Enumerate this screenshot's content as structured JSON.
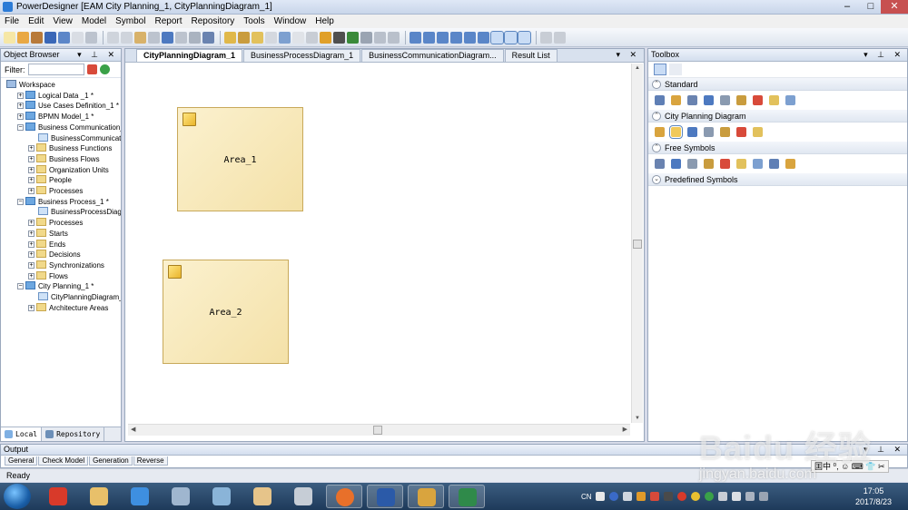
{
  "window": {
    "title": "PowerDesigner [EAM City Planning_1, CityPlanningDiagram_1]",
    "controls": {
      "minimize": "–",
      "maximize": "□",
      "close": "✕"
    }
  },
  "menu": [
    "File",
    "Edit",
    "View",
    "Model",
    "Symbol",
    "Report",
    "Repository",
    "Tools",
    "Window",
    "Help"
  ],
  "object_browser": {
    "title": "Object Browser",
    "controls": "▾ ⊥ ✕",
    "filter_label": "Filter:",
    "filter_value": "",
    "tree": [
      {
        "label": "Workspace",
        "icon": "ws",
        "exp": "",
        "level": 0
      },
      {
        "label": "Logical Data _1 *",
        "icon": "model",
        "exp": "+",
        "level": 1
      },
      {
        "label": "Use Cases Definition_1 *",
        "icon": "model",
        "exp": "+",
        "level": 1
      },
      {
        "label": "BPMN Model_1 *",
        "icon": "model",
        "exp": "+",
        "level": 1
      },
      {
        "label": "Business Communication_",
        "icon": "model",
        "exp": "−",
        "level": 1
      },
      {
        "label": "BusinessCommunicati",
        "icon": "diag",
        "exp": "",
        "level": 2
      },
      {
        "label": "Business Functions",
        "icon": "folder",
        "exp": "+",
        "level": 2
      },
      {
        "label": "Business Flows",
        "icon": "folder",
        "exp": "+",
        "level": 2
      },
      {
        "label": "Organization Units",
        "icon": "folder",
        "exp": "+",
        "level": 2
      },
      {
        "label": "People",
        "icon": "folder",
        "exp": "+",
        "level": 2
      },
      {
        "label": "Processes",
        "icon": "folder",
        "exp": "+",
        "level": 2
      },
      {
        "label": "Business Process_1 *",
        "icon": "model",
        "exp": "−",
        "level": 1
      },
      {
        "label": "BusinessProcessDiagr",
        "icon": "diag",
        "exp": "",
        "level": 2
      },
      {
        "label": "Processes",
        "icon": "folder",
        "exp": "+",
        "level": 2
      },
      {
        "label": "Starts",
        "icon": "folder",
        "exp": "+",
        "level": 2
      },
      {
        "label": "Ends",
        "icon": "folder",
        "exp": "+",
        "level": 2
      },
      {
        "label": "Decisions",
        "icon": "folder",
        "exp": "+",
        "level": 2
      },
      {
        "label": "Synchronizations",
        "icon": "folder",
        "exp": "+",
        "level": 2
      },
      {
        "label": "Flows",
        "icon": "folder",
        "exp": "+",
        "level": 2
      },
      {
        "label": "City Planning_1 *",
        "icon": "model",
        "exp": "−",
        "level": 1
      },
      {
        "label": "CityPlanningDiagram_1",
        "icon": "diag",
        "exp": "",
        "level": 2
      },
      {
        "label": "Architecture Areas",
        "icon": "folder",
        "exp": "+",
        "level": 2
      }
    ],
    "bottom_tabs": [
      {
        "label": "Local",
        "active": true
      },
      {
        "label": "Repository",
        "active": false
      }
    ]
  },
  "document": {
    "tabs": [
      {
        "label": "CityPlanningDiagram_1",
        "active": true
      },
      {
        "label": "BusinessProcessDiagram_1",
        "active": false
      },
      {
        "label": "BusinessCommunicationDiagram...",
        "active": false
      },
      {
        "label": "Result List",
        "active": false
      }
    ],
    "controls": "▾ ✕",
    "areas": [
      "Area_1",
      "Area_2"
    ]
  },
  "toolbox": {
    "title": "Toolbox",
    "controls": "▾ ⊥ ✕",
    "groups": [
      {
        "label": "Standard",
        "expanded": true,
        "tools": [
          "pointer-icon",
          "grabber-icon",
          "zoom-in-icon",
          "zoom-out-icon",
          "open-package-diagram-icon",
          "properties-icon",
          "delete-icon",
          "package-icon",
          "link-icon"
        ]
      },
      {
        "label": "City Planning Diagram",
        "expanded": true,
        "tools": [
          "site-icon",
          "area-icon",
          "server-icon",
          "database-icon",
          "component-icon",
          "hardware-icon",
          "document-icon"
        ]
      },
      {
        "label": "Free Symbols",
        "expanded": true,
        "tools": [
          "note-icon",
          "text-icon",
          "line-icon",
          "arc-icon",
          "rectangle-icon",
          "ellipse-icon",
          "rounded-rectangle-icon",
          "polyline-icon",
          "polygon-icon"
        ]
      },
      {
        "label": "Predefined Symbols",
        "expanded": false,
        "tools": []
      }
    ]
  },
  "output": {
    "title": "Output",
    "tabs": [
      "General",
      "Check Model",
      "Generation",
      "Reverse"
    ]
  },
  "status": {
    "text": "Ready"
  },
  "ime": {
    "text": "囯中 ⁰, ☺ ⌨ 👕 ✂"
  },
  "watermark": {
    "brand": "Baidu 经验",
    "url": "jingyan.baidu.com"
  },
  "taskbar": {
    "apps": [
      "hiper-icon",
      "file-explorer-icon",
      "internet-explorer-icon",
      "gear-app-icon",
      "settings-app-icon",
      "search-app-icon",
      "calculator-icon",
      "firefox-icon",
      "word-icon",
      "powerdesigner-icon",
      "excel-icon"
    ],
    "tray_lang": "CN",
    "time": "17:05",
    "date": "2017/8/23"
  },
  "colors": {
    "area_fill": "#f4e1a8",
    "area_border": "#c8a95a",
    "accent": "#2c7bd6"
  }
}
